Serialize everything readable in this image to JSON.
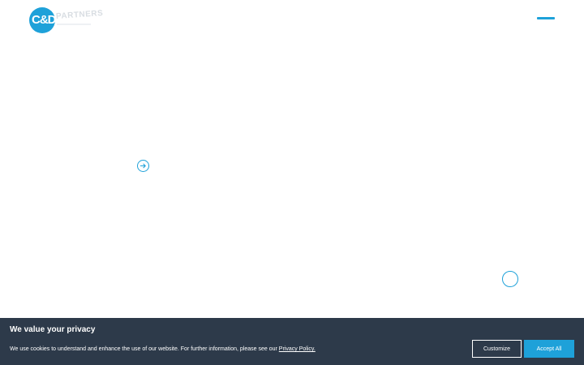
{
  "header": {
    "logo": {
      "letters": "C&D",
      "word": "PARTNERS",
      "brand_color": "#1ea1d9"
    },
    "menu_icon": "hamburger-icon"
  },
  "hero": {
    "next_icon": "arrow-right-icon",
    "scroll_icon": "scroll-down-icon"
  },
  "cookie_banner": {
    "title": "We value your privacy",
    "text": "We use cookies to understand and enhance the use of our website. For further information, please see our ",
    "link_label": "Privacy Policy.",
    "customize_label": "Customize",
    "accept_label": "Accept All",
    "background": "#2d3a4a",
    "accent": "#1ea1d9"
  }
}
